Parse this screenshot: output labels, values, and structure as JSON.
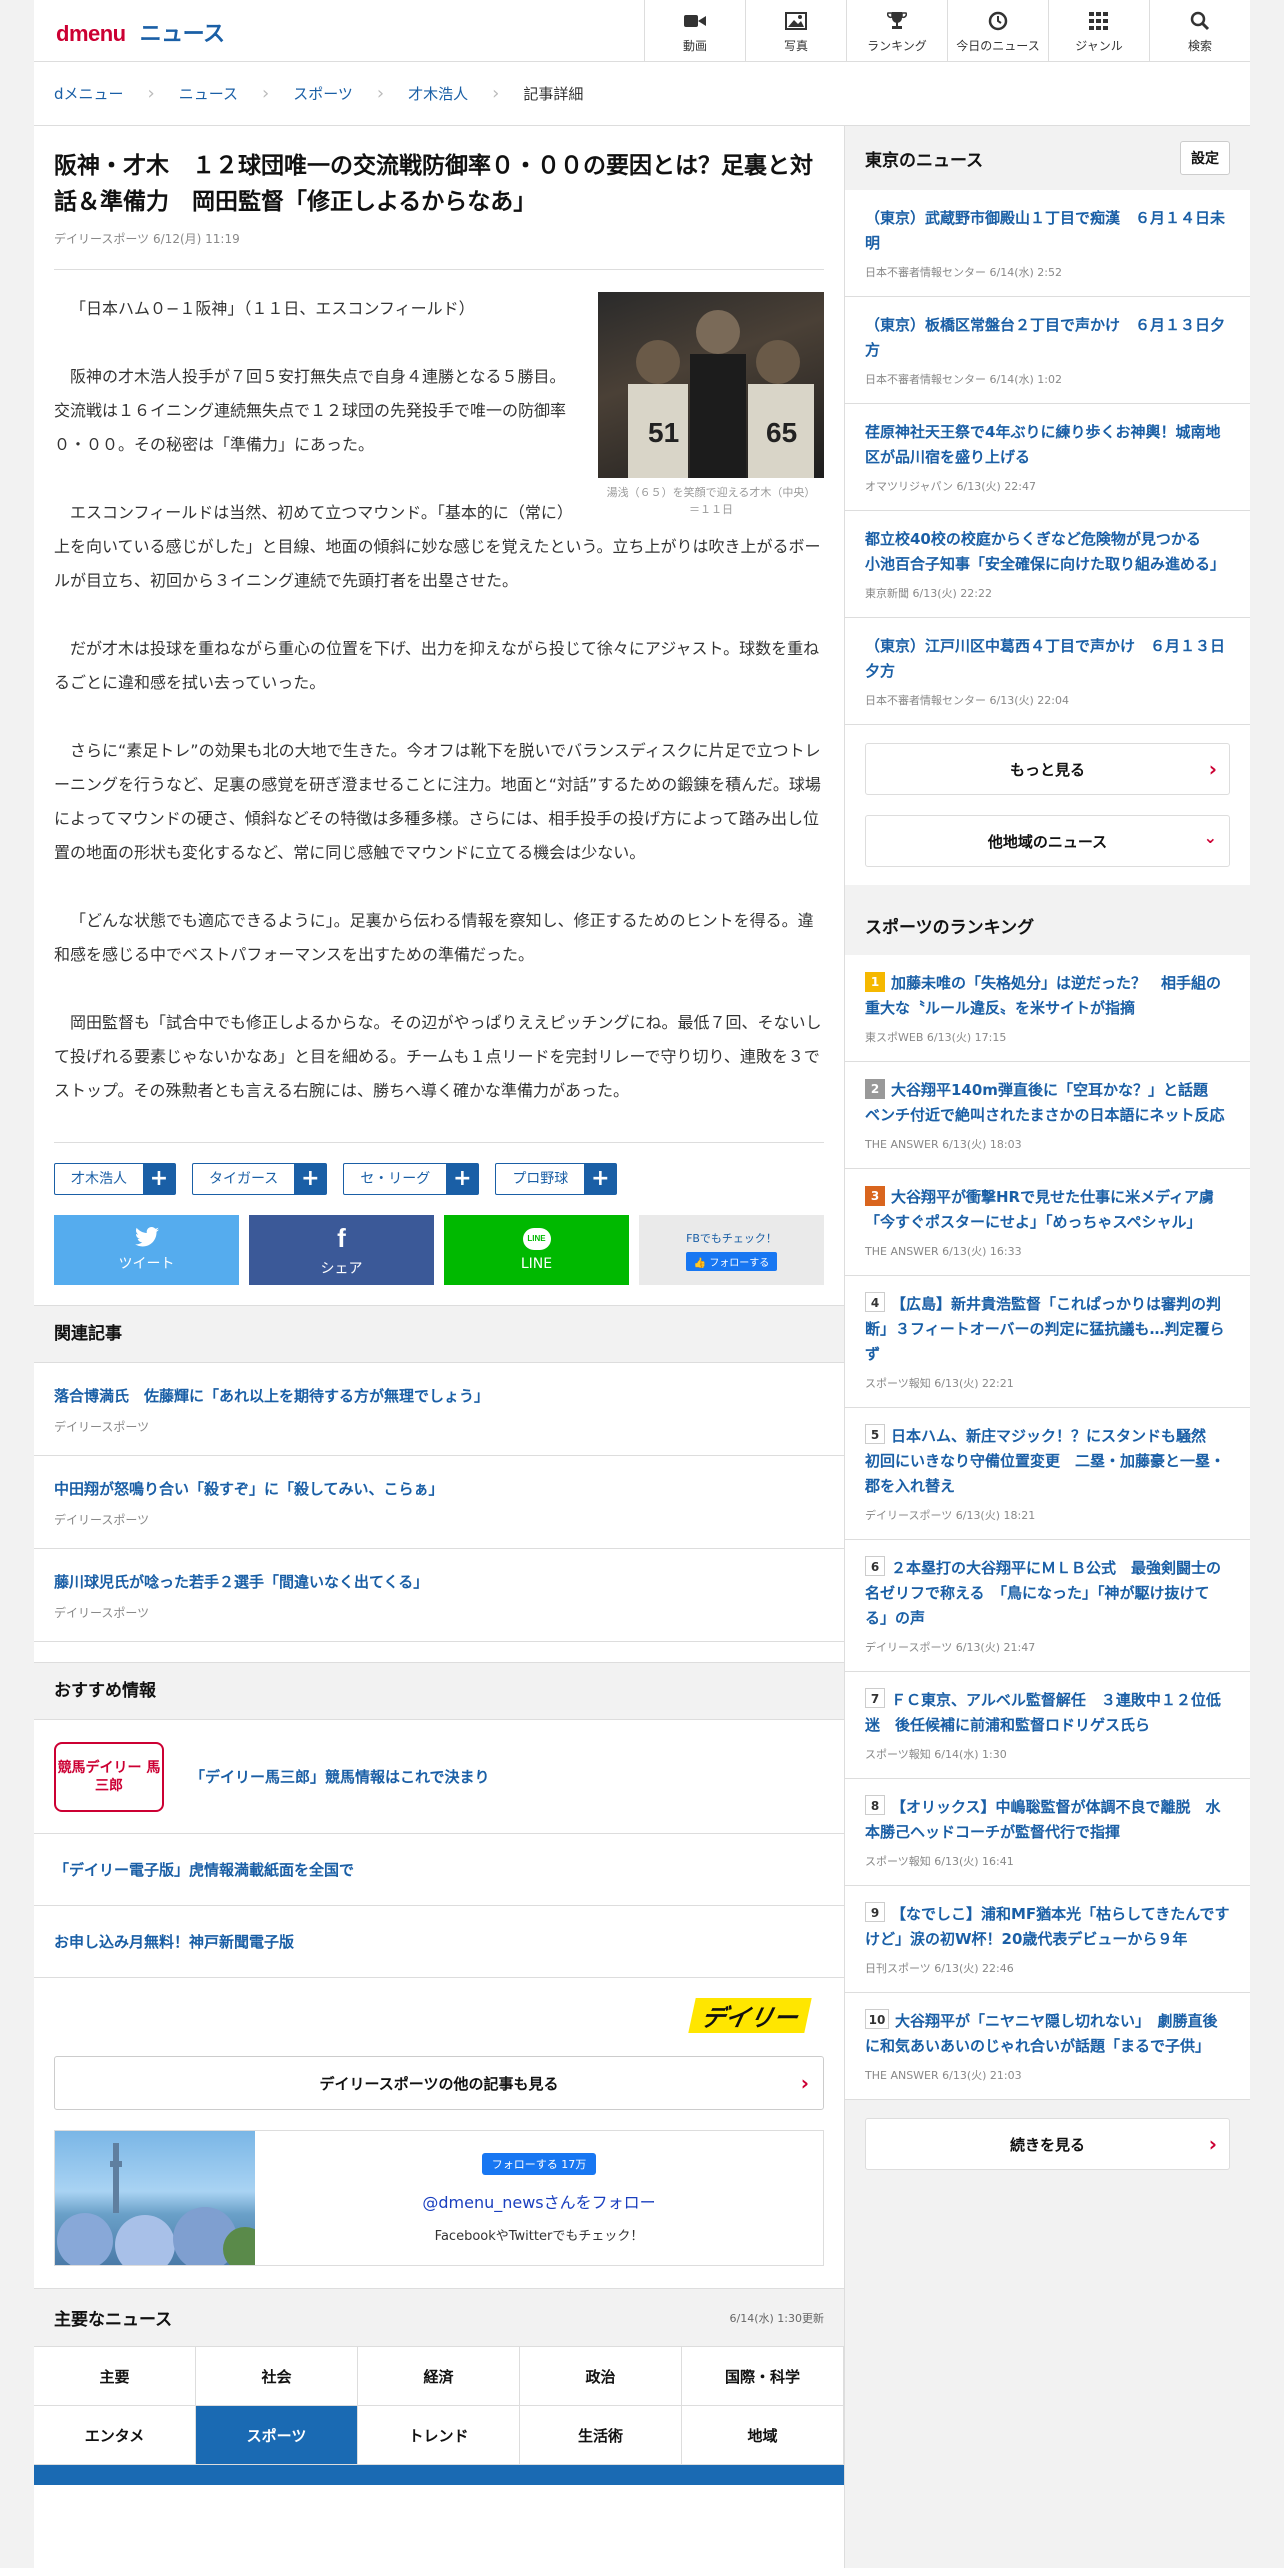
{
  "header": {
    "brand": "dmenu",
    "section": "ニュース",
    "nav": [
      {
        "label": "動画",
        "icon": "video-icon"
      },
      {
        "label": "写真",
        "icon": "photo-icon"
      },
      {
        "label": "ランキング",
        "icon": "trophy-icon"
      },
      {
        "label": "今日のニュース",
        "icon": "clock-icon"
      },
      {
        "label": "ジャンル",
        "icon": "grid-icon"
      },
      {
        "label": "検索",
        "icon": "search-icon"
      }
    ]
  },
  "breadcrumb": [
    "dメニュー",
    "ニュース",
    "スポーツ",
    "才木浩人",
    "記事詳細"
  ],
  "article": {
    "title": "阪神・才木　１２球団唯一の交流戦防御率０・００の要因とは？足裏と対話＆準備力　岡田監督「修正しよるからなあ」",
    "source": "デイリースポーツ",
    "date": "6/12(月) 11:19",
    "photo_caption": "湯浅（６５）を笑顔で迎える才木（中央）＝１１日",
    "paragraphs": [
      "「日本ハム０−１阪神」（１１日、エスコンフィールド）",
      "阪神の才木浩人投手が７回５安打無失点で自身４連勝となる５勝目。交流戦は１６イニング連続無失点で１２球団の先発投手で唯一の防御率０・００。その秘密は「準備力」にあった。",
      "エスコンフィールドは当然、初めて立つマウンド。「基本的に（常に）上を向いている感じがした」と目線、地面の傾斜に妙な感じを覚えたという。立ち上がりは吹き上がるボールが目立ち、初回から３イニング連続で先頭打者を出塁させた。",
      "だが才木は投球を重ねながら重心の位置を下げ、出力を抑えながら投じて徐々にアジャスト。球数を重ねるごとに違和感を拭い去っていった。",
      "さらに“素足トレ”の効果も北の大地で生きた。今オフは靴下を脱いでバランスディスクに片足で立つトレーニングを行うなど、足裏の感覚を研ぎ澄ませることに注力。地面と“対話”するための鍛錬を積んだ。球場によってマウンドの硬さ、傾斜などその特徴は多種多様。さらには、相手投手の投げ方によって踏み出し位置の地面の形状も変化するなど、常に同じ感触でマウンドに立てる機会は少ない。",
      "「どんな状態でも適応できるように」。足裏から伝わる情報を察知し、修正するためのヒントを得る。違和感を感じる中でベストパフォーマンスを出すための準備だった。",
      "岡田監督も「試合中でも修正しよるからな。その辺がやっぱりええピッチングにね。最低７回、そないして投げれる要素じゃないかなあ」と目を細める。チームも１点リードを完封リレーで守り切り、連敗を３でストップ。その殊勲者とも言える右腕には、勝ちへ導く確かな準備力があった。"
    ],
    "tags": [
      "才木浩人",
      "タイガース",
      "セ・リーグ",
      "プロ野球"
    ]
  },
  "share": {
    "tweet": "ツイート",
    "share": "シェア",
    "line": "LINE",
    "fb_check": "FBでもチェック！",
    "fb_follow": "フォローする"
  },
  "related": {
    "heading": "関連記事",
    "items": [
      {
        "title": "落合博満氏　佐藤輝に「あれ以上を期待する方が無理でしょう」",
        "source": "デイリースポーツ"
      },
      {
        "title": "中田翔が怒鳴り合い「殺すぞ」に「殺してみい、こらぁ」",
        "source": "デイリースポーツ"
      },
      {
        "title": "藤川球児氏が唸った若手２選手「間違いなく出てくる」",
        "source": "デイリースポーツ"
      }
    ]
  },
  "recommend": {
    "heading": "おすすめ情報",
    "banner_text": "競馬デイリー 馬三郎",
    "items": [
      "「デイリー馬三郎」競馬情報はこれで決まり",
      "「デイリー電子版」虎情報満載紙面を全国で",
      "お申し込み月無料！神戸新聞電子版"
    ]
  },
  "publisher": {
    "logo": "デイリー",
    "more": "デイリースポーツの他の記事も見る"
  },
  "follow": {
    "fb_button": "フォローする 17万",
    "handle": "@dmenu_newsさんをフォロー",
    "sub": "FacebookやTwitterでもチェック！"
  },
  "major": {
    "heading": "主要なニュース",
    "updated": "6/14(水) 1:30更新",
    "tabs": [
      "主要",
      "社会",
      "経済",
      "政治",
      "国際・科学",
      "エンタメ",
      "スポーツ",
      "トレンド",
      "生活術",
      "地域"
    ],
    "active": "スポーツ"
  },
  "side": {
    "tokyo": {
      "heading": "東京のニュース",
      "settings": "設定",
      "items": [
        {
          "title": "（東京）武蔵野市御殿山１丁目で痴漢　６月１４日未明",
          "source": "日本不審者情報センター",
          "date": "6/14(水) 2:52"
        },
        {
          "title": "（東京）板橋区常盤台２丁目で声かけ　６月１３日夕方",
          "source": "日本不審者情報センター",
          "date": "6/14(水) 1:02"
        },
        {
          "title": "荏原神社天王祭で4年ぶりに練り歩くお神輿！城南地区が品川宿を盛り上げる",
          "source": "オマツリジャパン",
          "date": "6/13(火) 22:47"
        },
        {
          "title": "都立校40校の校庭からくぎなど危険物が見つかる　小池百合子知事「安全確保に向けた取り組み進める」",
          "source": "東京新聞",
          "date": "6/13(火) 22:22"
        },
        {
          "title": "（東京）江戸川区中葛西４丁目で声かけ　６月１３日夕方",
          "source": "日本不審者情報センター",
          "date": "6/13(火) 22:04"
        }
      ],
      "more": "もっと見る",
      "other": "他地域のニュース"
    },
    "ranking": {
      "heading": "スポーツのランキング",
      "items": [
        {
          "rank": "1",
          "title": "加藤未唯の「失格処分」は逆だった？　相手組の重大な〝ルール違反〟を米サイトが指摘",
          "source": "東スポWEB",
          "date": "6/13(火) 17:15"
        },
        {
          "rank": "2",
          "title": "大谷翔平140m弾直後に「空耳かな？」と話題　ベンチ付近で絶叫されたまさかの日本語にネット反応",
          "source": "THE ANSWER",
          "date": "6/13(火) 18:03"
        },
        {
          "rank": "3",
          "title": "大谷翔平が衝撃HRで見せた仕事に米メディア虜「今すぐポスターにせよ」「めっちゃスペシャル」",
          "source": "THE ANSWER",
          "date": "6/13(火) 16:33"
        },
        {
          "rank": "4",
          "title": "【広島】新井貴浩監督「これぱっかりは審判の判断」３フィートオーバーの判定に猛抗議も…判定覆らず",
          "source": "スポーツ報知",
          "date": "6/13(火) 22:21"
        },
        {
          "rank": "5",
          "title": "日本ハム、新庄マジック！？にスタンドも騒然　初回にいきなり守備位置変更　二塁・加藤豪と一塁・郡を入れ替え",
          "source": "デイリースポーツ",
          "date": "6/13(火) 18:21"
        },
        {
          "rank": "6",
          "title": "２本塁打の大谷翔平にＭＬＢ公式　最強剣闘士の名ゼリフで称える　「鳥になった」「神が駆け抜けてる」の声",
          "source": "デイリースポーツ",
          "date": "6/13(火) 21:47"
        },
        {
          "rank": "7",
          "title": "ＦＣ東京、アルベル監督解任　３連敗中１２位低迷　後任候補に前浦和監督ロドリゲス氏ら",
          "source": "スポーツ報知",
          "date": "6/14(水) 1:30"
        },
        {
          "rank": "8",
          "title": "【オリックス】中嶋聡監督が体調不良で離脱　水本勝己ヘッドコーチが監督代行で指揮",
          "source": "スポーツ報知",
          "date": "6/13(火) 16:41"
        },
        {
          "rank": "9",
          "title": "【なでしこ】浦和MF猶本光「枯らしてきたんですけど」涙の初W杯！20歳代表デビューから９年",
          "source": "日刊スポーツ",
          "date": "6/13(火) 22:46"
        },
        {
          "rank": "10",
          "title": "大谷翔平が「ニヤニヤ隠し切れない」　劇勝直後に和気あいあいのじゃれ合いが話題「まるで子供」",
          "source": "THE ANSWER",
          "date": "6/13(火) 21:03"
        }
      ],
      "more": "続きを見る"
    }
  },
  "colors": {
    "accent": "#1a5fa6",
    "brand": "#cc0033",
    "twitter": "#55acee",
    "facebook": "#3b5998",
    "line": "#00b900",
    "rank1": "#f5b800",
    "rank2": "#999999",
    "rank3": "#d9651e"
  }
}
